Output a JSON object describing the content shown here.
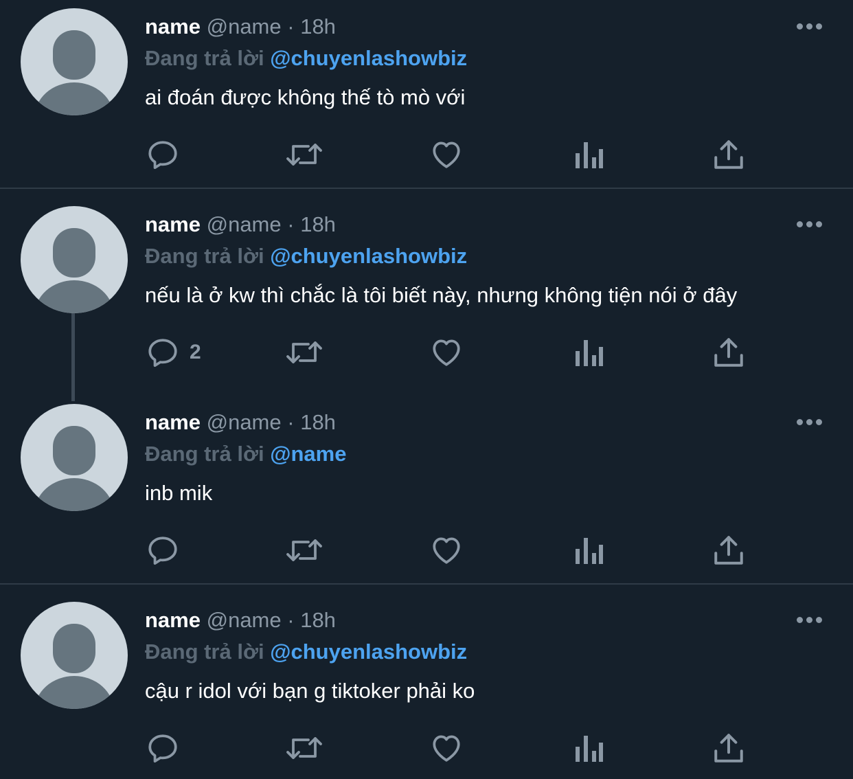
{
  "tweets": [
    {
      "name": "name",
      "handle": "@name",
      "separator": "·",
      "time": "18h",
      "replying_prefix": "Đang trả lời",
      "replying_to": "@chuyenlashowbiz",
      "text": "ai đoán được không thế tò mò với",
      "reply_count": ""
    },
    {
      "name": "name",
      "handle": "@name",
      "separator": "·",
      "time": "18h",
      "replying_prefix": "Đang trả lời",
      "replying_to": "@chuyenlashowbiz",
      "text": "nếu là ở kw thì chắc là tôi biết này, nhưng không tiện nói ở đây",
      "reply_count": "2"
    },
    {
      "name": "name",
      "handle": "@name",
      "separator": "·",
      "time": "18h",
      "replying_prefix": "Đang trả lời",
      "replying_to": "@name",
      "text": "inb mik",
      "reply_count": ""
    },
    {
      "name": "name",
      "handle": "@name",
      "separator": "·",
      "time": "18h",
      "replying_prefix": "Đang trả lời",
      "replying_to": "@chuyenlashowbiz",
      "text": "cậu r idol với bạn g tiktoker phải ko",
      "reply_count": ""
    }
  ],
  "icons": {
    "avatar": "default-avatar-icon",
    "more": "more-horizontal-icon",
    "reply": "reply-icon",
    "retweet": "retweet-icon",
    "like": "like-icon",
    "analytics": "analytics-icon",
    "share": "share-icon"
  },
  "colors": {
    "background": "#15202b",
    "text": "#ffffff",
    "secondary": "#8b98a5",
    "mention": "#4da3f0",
    "divider": "#2f3b47"
  }
}
